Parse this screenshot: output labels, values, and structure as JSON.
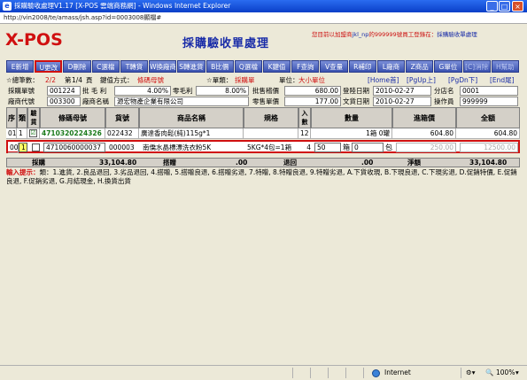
{
  "window": {
    "title": "採購驗收處理V1.17 [X-POS 雲端商務網] - Windows Internet Explorer",
    "address": "http://vin2008/te/amass/jsh.asp?id=0003008顯檔#"
  },
  "header": {
    "logo": "X-POS",
    "page_title": "採購驗收單處理",
    "welcome_prefix": "您目前以加盟商",
    "user_code": "jkl_np",
    "welcome_mid": "的999999號員工登錄在：",
    "current_module": "採購驗收單處理"
  },
  "toolbar": {
    "buttons": [
      {
        "label": "E新增",
        "state": "normal"
      },
      {
        "label": "U更改",
        "state": "highlighted"
      },
      {
        "label": "D刪除",
        "state": "normal"
      },
      {
        "label": "C選檔",
        "state": "normal"
      },
      {
        "label": "T轉貨",
        "state": "normal"
      },
      {
        "label": "W換廠商",
        "state": "normal"
      },
      {
        "label": "S轉進貨",
        "state": "normal"
      },
      {
        "label": "B比價",
        "state": "normal"
      },
      {
        "label": "Q選檔",
        "state": "normal"
      },
      {
        "label": "K鍵值",
        "state": "normal"
      },
      {
        "label": "F查詢",
        "state": "normal"
      },
      {
        "label": "V查量",
        "state": "normal"
      },
      {
        "label": "R補印",
        "state": "normal"
      },
      {
        "label": "L廠商",
        "state": "normal"
      },
      {
        "label": "Z商品",
        "state": "normal"
      },
      {
        "label": "G單位",
        "state": "normal"
      },
      {
        "label": "[C]消除",
        "state": "dim"
      },
      {
        "label": "H幫助",
        "state": "dim"
      }
    ]
  },
  "status_row": {
    "total_label": "☆總筆數：",
    "total_value": "2/2",
    "page_label": "第",
    "page_value": "1/4",
    "page_suffix": "頁",
    "key_label": "鍵值方式：",
    "key_value": "條碼母號",
    "type_label": "☆單類：",
    "type_value": "採購單",
    "unit_label": "單位：",
    "unit_value": "大小單位",
    "nav": [
      "[Home首]",
      "[PgUp上]",
      "[PgDn下]",
      "[End尾]"
    ]
  },
  "form": {
    "order_no_label": "採購單號",
    "order_no": "001224",
    "gross_label": "批 毛 利",
    "gross_value": "4.00%",
    "retail_gross_label": "零毛利",
    "retail_gross_value": "8.00%",
    "wholesale_total_label": "批售稽價",
    "wholesale_total": "680.00",
    "login_date_label": "登陸日期",
    "login_date": "2010-02-27",
    "branch_label": "分店名",
    "branch_value": "0001",
    "vendor_code_label": "廠商代號",
    "vendor_code": "003300",
    "vendor_name_label": "廠商名稱",
    "vendor_name": "源宏物產企業有限公司",
    "retail_total_label": "零售單價",
    "retail_total": "177.00",
    "doc_date_label": "文貨日期",
    "doc_date": "2010-02-27",
    "operator_label": "操作員",
    "operator_value": "999999"
  },
  "grid": {
    "headers": [
      "序",
      "類",
      "驗貨",
      "條碼母號",
      "貨號",
      "商品名稱",
      "規格",
      "入數",
      "數量",
      "進箱價",
      "全額"
    ],
    "rows": [
      {
        "seq": "01",
        "kind": "1",
        "checked": "☑",
        "barcode": "4710320224326",
        "item_no": "022432",
        "name": "廣達香肉鬆(純)115g*1",
        "spec": "",
        "pack": "12",
        "qty": "1箱 0罐",
        "price": "604.80",
        "amount": "604.80"
      },
      {
        "seq": "00",
        "kind": "1",
        "checked": "",
        "barcode": "4710060000037",
        "item_no": "000003",
        "name": "南僑水晶標漂洗衣粉5K",
        "spec": "5KG*4包=1箱",
        "pack": "4",
        "qty_box": "50",
        "qty_box_unit": "箱",
        "qty_pack": "0",
        "qty_pack_unit": "包",
        "price": "250.00",
        "amount": "12500.00"
      }
    ]
  },
  "totals": {
    "purchase_label": "採購",
    "purchase": "33,104.80",
    "flag_label": "搭贈",
    "flag": ".00",
    "return_label": "退回",
    "return_value": ".00",
    "net_label": "淨額",
    "net": "33,104.80"
  },
  "help": {
    "title": "輸入提示：",
    "text": "類：1.進貨, 2.良品退回, 3.劣品退回, 4.搭贈, 5.搭贈良退, 6.搭贈劣退, 7.特贈, 8.特贈良退, 9.特贈劣退, A.下貨收現, B.下現良退, C.下現劣退, D.促銷特價, E.促銷良退, F.促銷劣退, G.月結現金, H.換貨出貨"
  },
  "statusbar": {
    "zone": "Internet",
    "zoom": "100%"
  },
  "colors": {
    "titlebar": "#0a3fc8",
    "toolbar": "#3a52b0",
    "accent_red": "#d01010",
    "accent_blue": "#1a2da8"
  }
}
